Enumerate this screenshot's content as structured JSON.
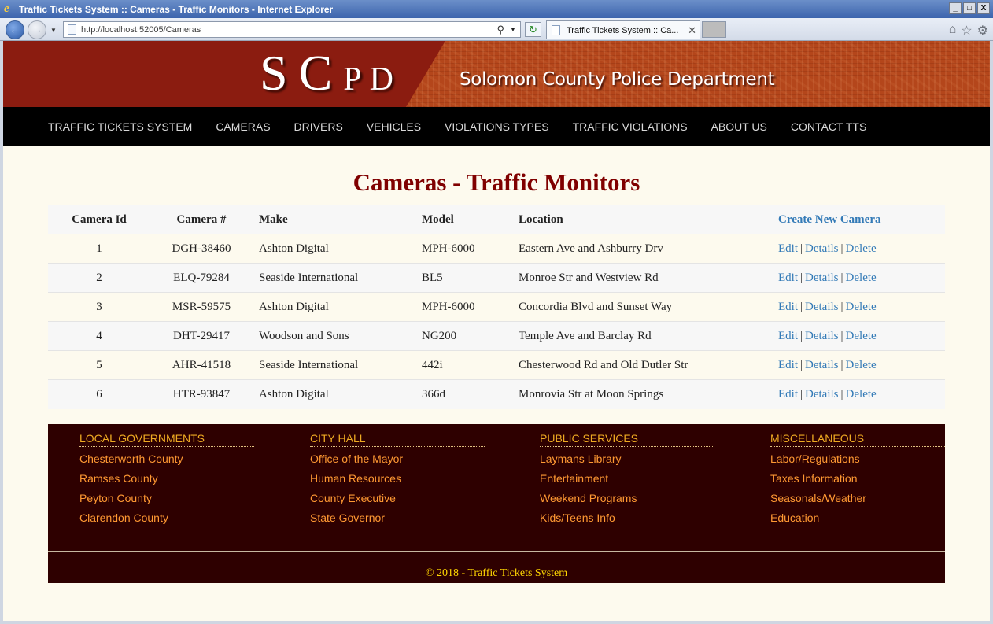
{
  "browser": {
    "window_title": "Traffic Tickets System :: Cameras - Traffic Monitors - Internet Explorer",
    "url": "http://localhost:52005/Cameras",
    "tab_title": "Traffic Tickets System :: Ca...",
    "minimize": "_",
    "maximize": "□",
    "close": "X"
  },
  "header": {
    "logo_s": "S",
    "logo_c": "C",
    "logo_p": "P",
    "logo_d": "D",
    "department": "Solomon County Police Department"
  },
  "nav": {
    "items": [
      "TRAFFIC TICKETS SYSTEM",
      "CAMERAS",
      "DRIVERS",
      "VEHICLES",
      "VIOLATIONS TYPES",
      "TRAFFIC VIOLATIONS",
      "ABOUT US",
      "CONTACT TTS"
    ]
  },
  "main": {
    "title": "Cameras - Traffic Monitors",
    "columns": [
      "Camera Id",
      "Camera #",
      "Make",
      "Model",
      "Location"
    ],
    "create_link": "Create New Camera",
    "action_edit": "Edit",
    "action_details": "Details",
    "action_delete": "Delete",
    "separator": "|",
    "rows": [
      {
        "id": "1",
        "number": "DGH-38460",
        "make": "Ashton Digital",
        "model": "MPH-6000",
        "location": "Eastern Ave and Ashburry Drv"
      },
      {
        "id": "2",
        "number": "ELQ-79284",
        "make": "Seaside International",
        "model": "BL5",
        "location": "Monroe Str and Westview Rd"
      },
      {
        "id": "3",
        "number": "MSR-59575",
        "make": "Ashton Digital",
        "model": "MPH-6000",
        "location": "Concordia Blvd and Sunset Way"
      },
      {
        "id": "4",
        "number": "DHT-29417",
        "make": "Woodson and Sons",
        "model": "NG200",
        "location": "Temple Ave and Barclay Rd"
      },
      {
        "id": "5",
        "number": "AHR-41518",
        "make": "Seaside International",
        "model": "442i",
        "location": "Chesterwood Rd and Old Dutler Str"
      },
      {
        "id": "6",
        "number": "HTR-93847",
        "make": "Ashton Digital",
        "model": "366d",
        "location": "Monrovia Str at Moon Springs"
      }
    ]
  },
  "footer": {
    "columns": [
      {
        "heading": "LOCAL GOVERNMENTS",
        "links": [
          "Chesterworth County",
          "Ramses County",
          "Peyton County",
          "Clarendon County"
        ]
      },
      {
        "heading": "CITY HALL",
        "links": [
          "Office of the Mayor",
          "Human Resources",
          "County Executive",
          "State Governor"
        ]
      },
      {
        "heading": "PUBLIC SERVICES",
        "links": [
          "Laymans Library",
          "Entertainment",
          "Weekend Programs",
          "Kids/Teens Info"
        ]
      },
      {
        "heading": "MISCELLANEOUS",
        "links": [
          "Labor/Regulations",
          "Taxes Information",
          "Seasonals/Weather",
          "Education"
        ]
      }
    ],
    "copyright": "© 2018 - Traffic Tickets System"
  },
  "colors": {
    "title_red": "#800000",
    "link_blue": "#337ab7",
    "footer_bg": "#2e0000",
    "footer_link": "#ff9933",
    "footer_heading": "#eeaa22",
    "copyright": "#ffd700",
    "page_bg": "#fdfaee"
  }
}
